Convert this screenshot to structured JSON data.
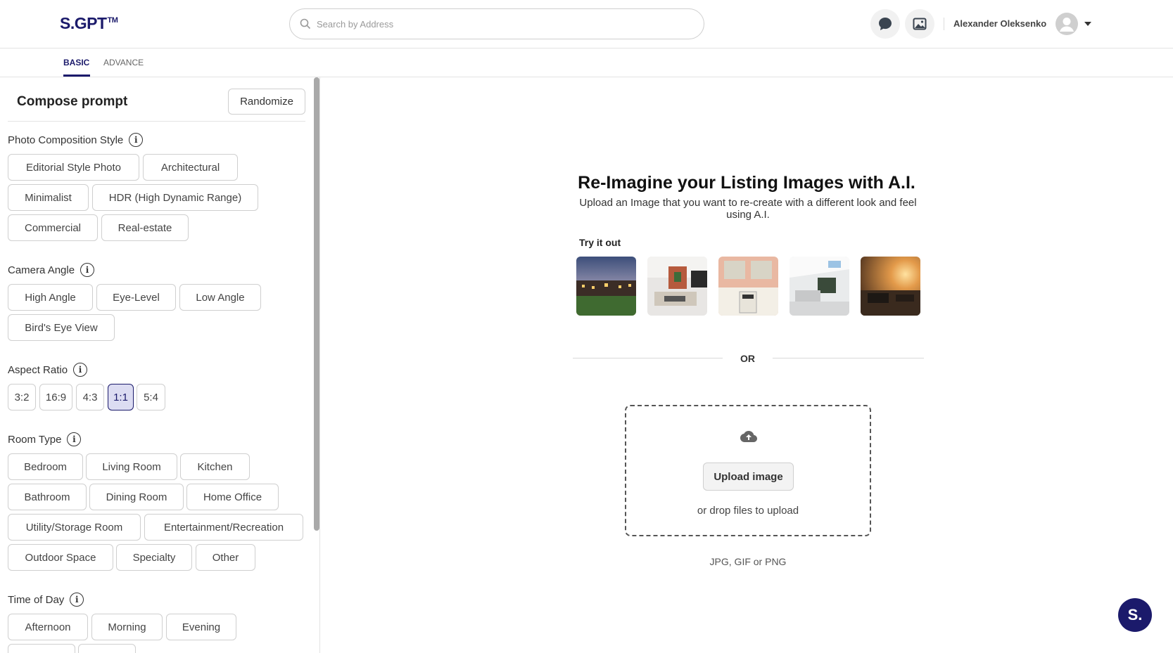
{
  "header": {
    "logo_text": "S.GPT",
    "logo_tm": "TM",
    "search_placeholder": "Search by Address",
    "username": "Alexander Oleksenko"
  },
  "tabs": [
    {
      "label": "BASIC",
      "active": true
    },
    {
      "label": "ADVANCE",
      "active": false
    }
  ],
  "sidebar": {
    "title": "Compose prompt",
    "randomize_label": "Randomize",
    "sections": {
      "composition": {
        "label": "Photo Composition Style",
        "options": [
          "Editorial Style Photo",
          "Architectural",
          "Minimalist",
          "HDR (High Dynamic Range)",
          "Commercial",
          "Real-estate"
        ]
      },
      "camera": {
        "label": "Camera Angle",
        "options": [
          "High Angle",
          "Eye-Level",
          "Low Angle",
          "Bird's Eye View"
        ]
      },
      "aspect": {
        "label": "Aspect Ratio",
        "options": [
          "3:2",
          "16:9",
          "4:3",
          "1:1",
          "5:4"
        ],
        "selected": "1:1"
      },
      "room": {
        "label": "Room Type",
        "options": [
          "Bedroom",
          "Living Room",
          "Kitchen",
          "Bathroom",
          "Dining Room",
          "Home Office",
          "Utility/Storage Room",
          "Entertainment/Recreation",
          "Outdoor Space",
          "Specialty",
          "Other"
        ]
      },
      "time": {
        "label": "Time of Day",
        "options": [
          "Afternoon",
          "Morning",
          "Evening"
        ]
      }
    }
  },
  "main": {
    "title": "Re-Imagine your Listing Images with A.I.",
    "subtitle": "Upload an Image that you want to re-create with a different look and feel using A.I.",
    "try_label": "Try it out",
    "or_label": "OR",
    "upload_label": "Upload image",
    "drop_text": "or drop files to upload",
    "formats": "JPG, GIF or PNG",
    "fab_label": "S."
  },
  "colors": {
    "brand": "#1b1a6b",
    "selected_bg": "#dcdcf2"
  }
}
